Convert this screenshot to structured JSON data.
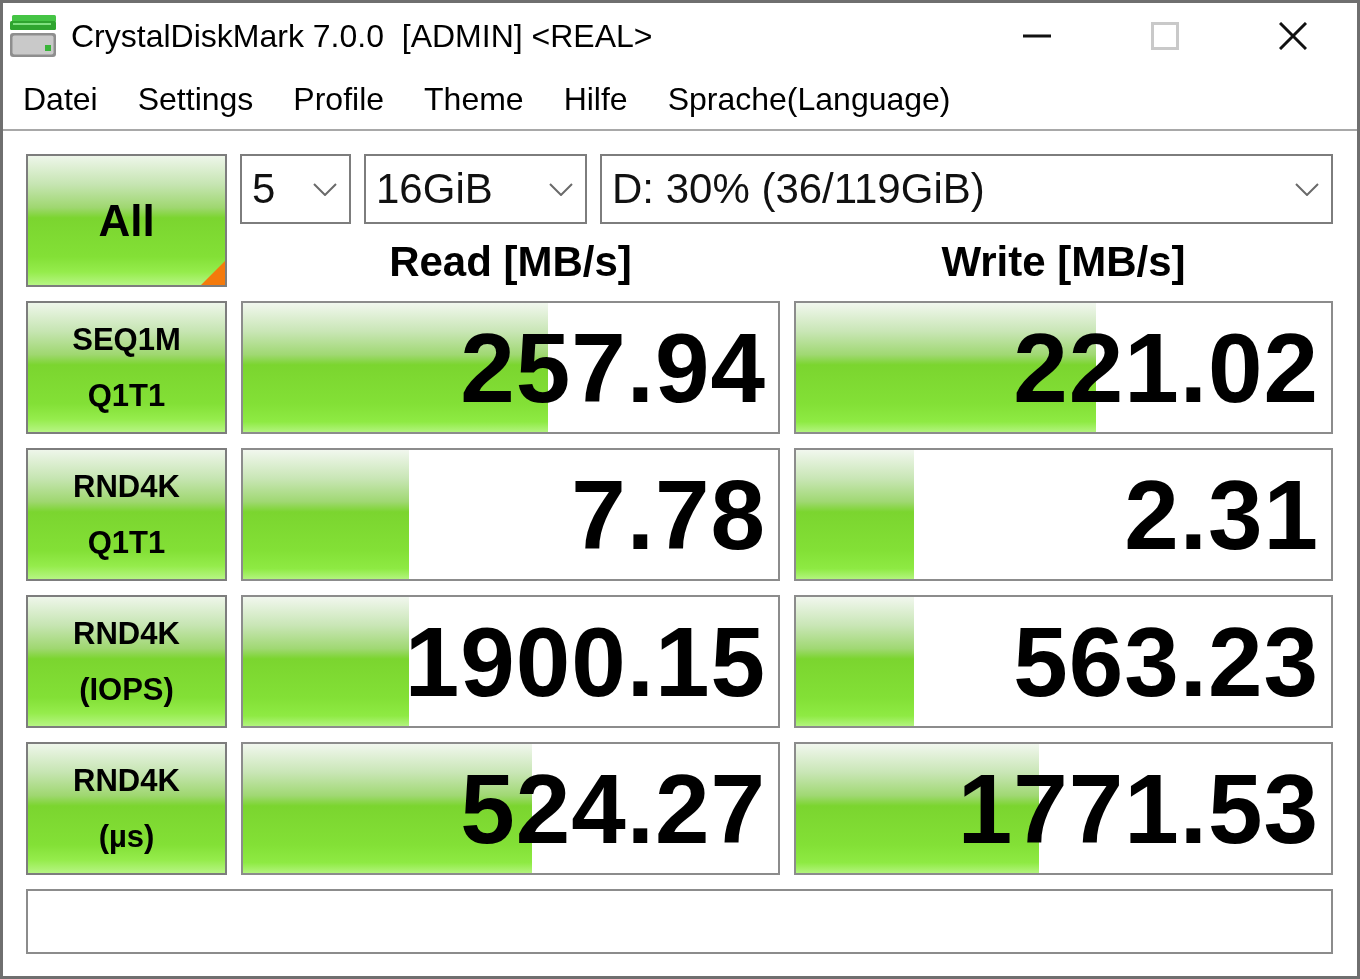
{
  "window": {
    "title": "CrystalDiskMark 7.0.0  [ADMIN] <REAL>",
    "controls": [
      {
        "kind": "minimize",
        "disabled": false
      },
      {
        "kind": "maximize",
        "disabled": true
      },
      {
        "kind": "close",
        "disabled": false
      }
    ]
  },
  "menu": [
    {
      "label": "Datei"
    },
    {
      "label": "Settings"
    },
    {
      "label": "Profile"
    },
    {
      "label": "Theme"
    },
    {
      "label": "Hilfe"
    },
    {
      "label": "Sprache(Language)"
    }
  ],
  "all_button": {
    "label": "All"
  },
  "selectors": [
    {
      "value": "5"
    },
    {
      "value": "16GiB"
    },
    {
      "value": "D: 30% (36/119GiB)"
    }
  ],
  "columns": [
    "Read [MB/s]",
    "Write [MB/s]"
  ],
  "tests": [
    {
      "label": [
        "SEQ1M",
        "Q1T1"
      ],
      "read": {
        "value": "257.94",
        "level": 0.57
      },
      "write": {
        "value": "221.02",
        "level": 0.56
      }
    },
    {
      "label": [
        "RND4K",
        "Q1T1"
      ],
      "read": {
        "value": "7.78",
        "level": 0.31
      },
      "write": {
        "value": "2.31",
        "level": 0.22
      }
    },
    {
      "label": [
        "RND4K",
        "(IOPS)"
      ],
      "read": {
        "value": "1900.15",
        "level": 0.31
      },
      "write": {
        "value": "563.23",
        "level": 0.22
      }
    },
    {
      "label": [
        "RND4K",
        "(µs)"
      ],
      "read": {
        "value": "524.27",
        "level": 0.54
      },
      "write": {
        "value": "1771.53",
        "level": 0.455
      }
    }
  ]
}
